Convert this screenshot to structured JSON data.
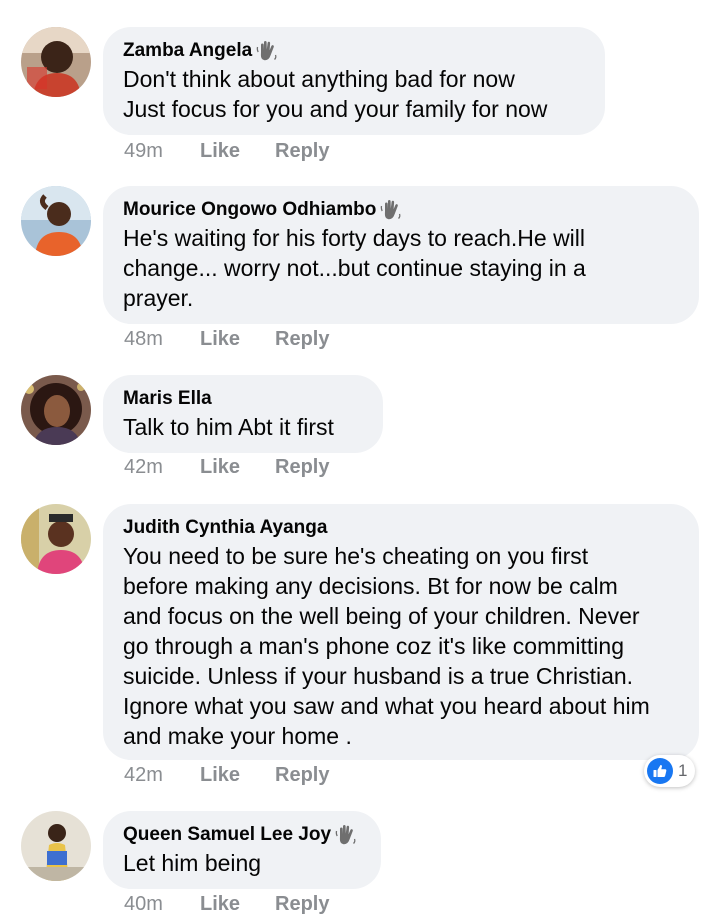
{
  "top_stub": "···",
  "comments": [
    {
      "author": "Zamba Angela",
      "show_wave": true,
      "text": "Don't think about anything bad for now\nJust focus for you and your family for now",
      "time": "49m",
      "like": "Like",
      "reply": "Reply"
    },
    {
      "author": "Mourice Ongowo Odhiambo",
      "show_wave": true,
      "text": "He's waiting for his forty days to reach.He will\nchange... worry not...but continue staying in a\nprayer.",
      "time": "48m",
      "like": "Like",
      "reply": "Reply"
    },
    {
      "author": "Maris Ella",
      "show_wave": false,
      "text": "Talk to him Abt it first",
      "time": "42m",
      "like": "Like",
      "reply": "Reply"
    },
    {
      "author": "Judith Cynthia Ayanga",
      "show_wave": false,
      "text": "You need to be sure he's cheating on you first\nbefore making any decisions. Bt for now be calm\nand focus  on the well being of your children. Never\ngo through a man's phone coz it's like committing\nsuicide. Unless if your husband is a true Christian.\nIgnore what you saw and what you heard about him\nand make your home .",
      "time": "42m",
      "like": "Like",
      "reply": "Reply",
      "reaction_count": "1"
    },
    {
      "author": "Queen Samuel Lee Joy",
      "show_wave": true,
      "text": "Let him being",
      "time": "40m",
      "like": "Like",
      "reply": "Reply"
    }
  ],
  "colors": {
    "bubble": "#f0f2f5",
    "meta_text": "#8a8d91",
    "like_blue": "#1877f2"
  }
}
